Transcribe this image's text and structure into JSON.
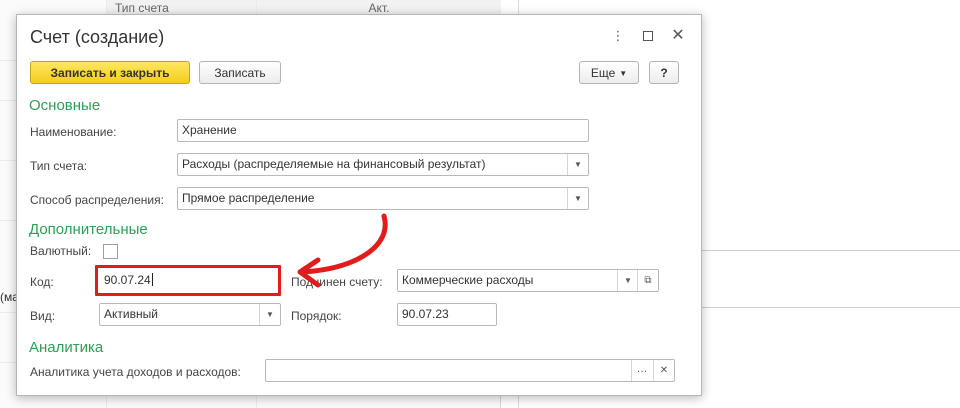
{
  "background": {
    "table_header_col1": "Тип счета",
    "table_header_col2": "Акт.",
    "edge_fragment": "(ма"
  },
  "dialog": {
    "title": "Счет (создание)",
    "titlebar_icons": [
      "more-vertical-icon",
      "maximize-icon",
      "close-icon"
    ],
    "toolbar": {
      "save_close_label": "Записать и закрыть",
      "save_label": "Записать",
      "more_label": "Еще",
      "help_label": "?"
    },
    "sections": {
      "main": "Основные",
      "additional": "Дополнительные",
      "analytics": "Аналитика"
    },
    "fields": {
      "name_label": "Наименование:",
      "name_value": "Хранение",
      "account_type_label": "Тип счета:",
      "account_type_value": "Расходы (распределяемые на финансовый результат)",
      "distribution_label": "Способ распределения:",
      "distribution_value": "Прямое распределение",
      "currency_label": "Валютный:",
      "code_label": "Код:",
      "code_value": "90.07.24",
      "parent_label": "Подчинен счету:",
      "parent_value": "Коммерческие расходы",
      "kind_label": "Вид:",
      "kind_value": "Активный",
      "order_label": "Порядок:",
      "order_value": "90.07.23",
      "analytics_label": "Аналитика учета доходов и расходов:",
      "analytics_value": ""
    }
  },
  "colors": {
    "section_green": "#2f9e54",
    "primary_button": "#f4cd1c",
    "highlight_red": "#e01c1c"
  }
}
